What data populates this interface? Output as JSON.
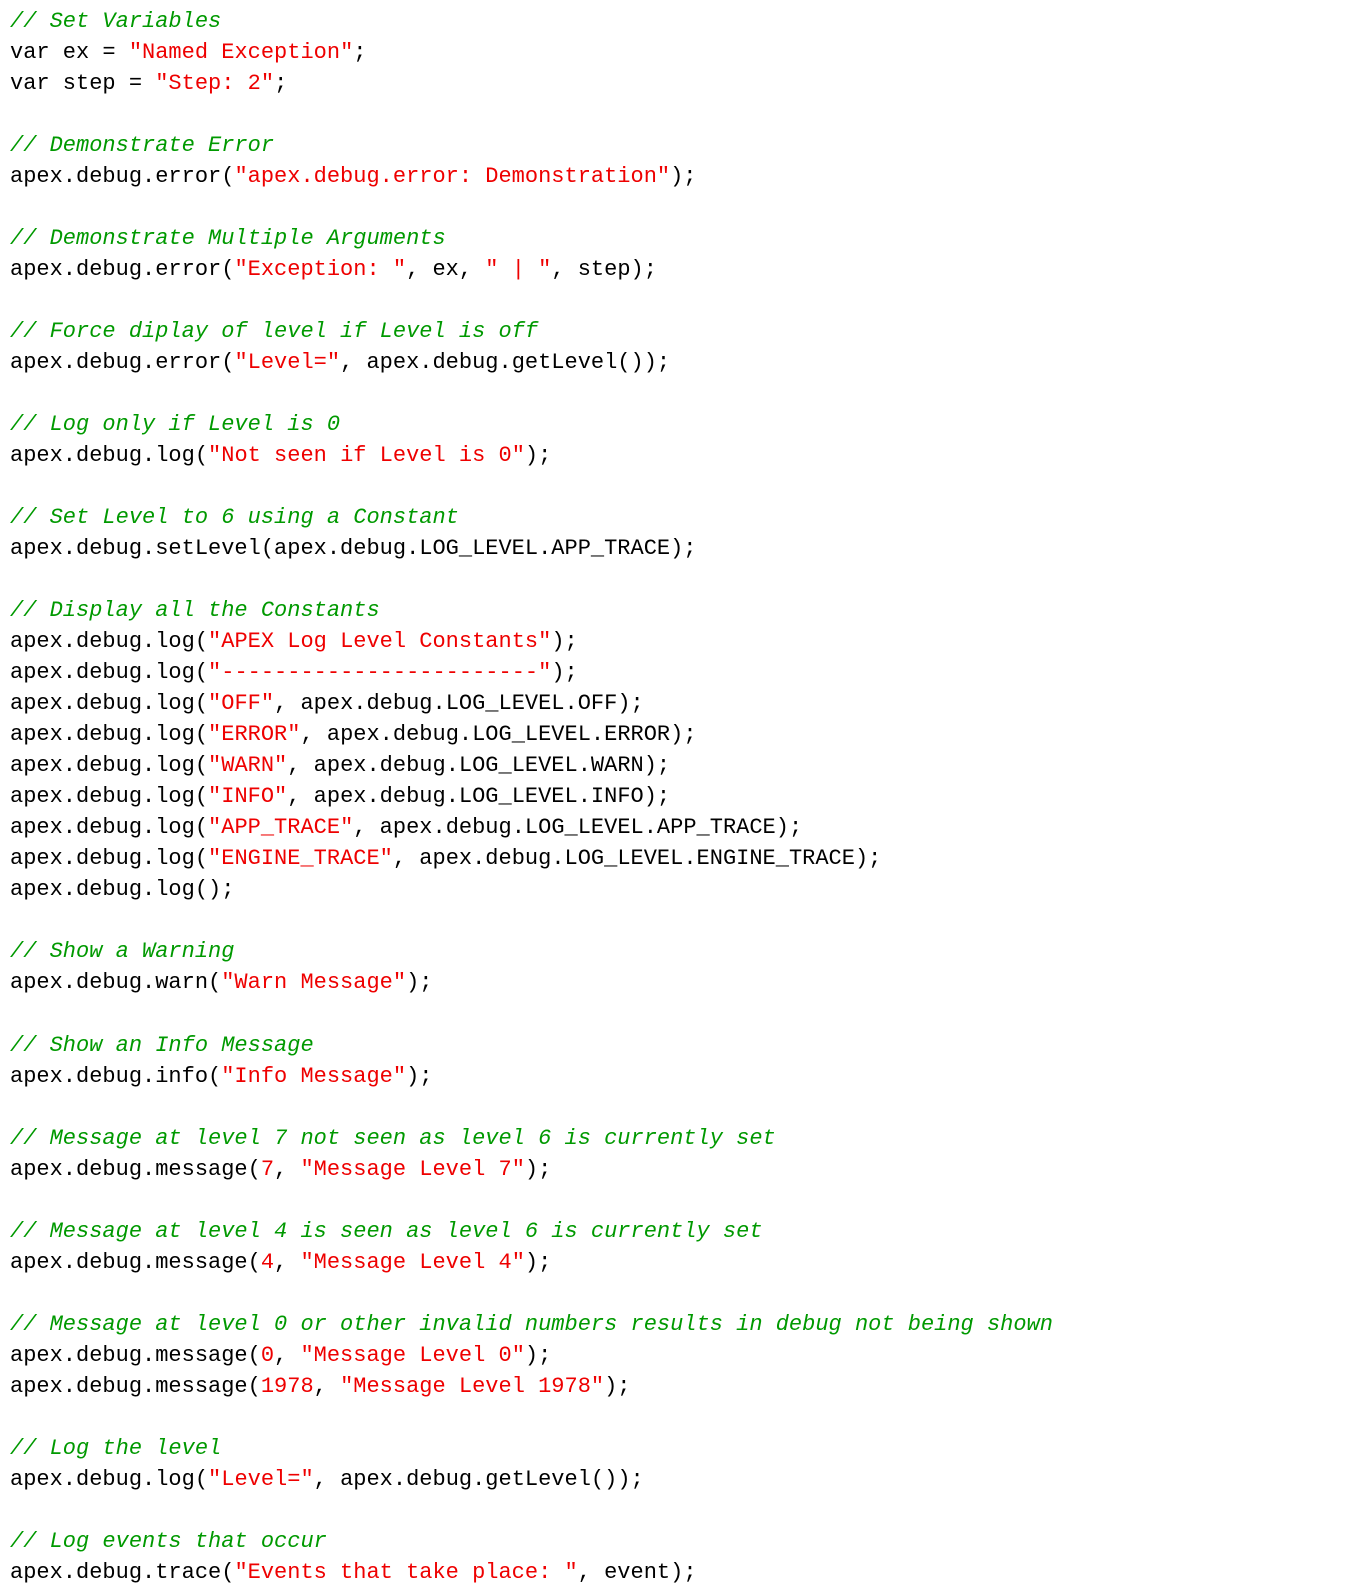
{
  "code_text": {
    "c_set_vars": "// Set Variables",
    "l_var_ex_pre": "var ex = ",
    "l_var_ex_str": "\"Named Exception\"",
    "l_var_ex_post": ";",
    "l_var_step_pre": "var step = ",
    "l_var_step_str": "\"Step: 2\"",
    "l_var_step_post": ";",
    "c_demo_error": "// Demonstrate Error",
    "l_demo_error_pre": "apex.debug.error(",
    "l_demo_error_str": "\"apex.debug.error: Demonstration\"",
    "l_demo_error_post": ");",
    "c_demo_multi": "// Demonstrate Multiple Arguments",
    "l_multi_pre": "apex.debug.error(",
    "l_multi_s1": "\"Exception: \"",
    "l_multi_sep1": ", ex, ",
    "l_multi_s2": "\" | \"",
    "l_multi_post": ", step);",
    "c_force": "// Force diplay of level if Level is off",
    "l_force_pre": "apex.debug.error(",
    "l_force_str": "\"Level=\"",
    "l_force_post": ", apex.debug.getLevel());",
    "c_logonly": "// Log only if Level is 0",
    "l_logonly_pre": "apex.debug.log(",
    "l_logonly_str": "\"Not seen if Level is 0\"",
    "l_logonly_post": ");",
    "c_setlevel": "// Set Level to 6 using a Constant",
    "l_setlevel": "apex.debug.setLevel(apex.debug.LOG_LEVEL.APP_TRACE);",
    "c_displayconst": "// Display all the Constants",
    "l_dc_a_pre": "apex.debug.log(",
    "l_dc_a_str": "\"APEX Log Level Constants\"",
    "l_dc_a_post": ");",
    "l_dc_b_pre": "apex.debug.log(",
    "l_dc_b_str": "\"------------------------\"",
    "l_dc_b_post": ");",
    "l_dc_off_pre": "apex.debug.log(",
    "l_dc_off_str": "\"OFF\"",
    "l_dc_off_post": ", apex.debug.LOG_LEVEL.OFF);",
    "l_dc_err_pre": "apex.debug.log(",
    "l_dc_err_str": "\"ERROR\"",
    "l_dc_err_post": ", apex.debug.LOG_LEVEL.ERROR);",
    "l_dc_warn_pre": "apex.debug.log(",
    "l_dc_warn_str": "\"WARN\"",
    "l_dc_warn_post": ", apex.debug.LOG_LEVEL.WARN);",
    "l_dc_info_pre": "apex.debug.log(",
    "l_dc_info_str": "\"INFO\"",
    "l_dc_info_post": ", apex.debug.LOG_LEVEL.INFO);",
    "l_dc_appt_pre": "apex.debug.log(",
    "l_dc_appt_str": "\"APP_TRACE\"",
    "l_dc_appt_post": ", apex.debug.LOG_LEVEL.APP_TRACE);",
    "l_dc_engt_pre": "apex.debug.log(",
    "l_dc_engt_str": "\"ENGINE_TRACE\"",
    "l_dc_engt_post": ", apex.debug.LOG_LEVEL.ENGINE_TRACE);",
    "l_dc_empty": "apex.debug.log();",
    "c_showwarn": "// Show a Warning",
    "l_showwarn_pre": "apex.debug.warn(",
    "l_showwarn_str": "\"Warn Message\"",
    "l_showwarn_post": ");",
    "c_showinfo": "// Show an Info Message",
    "l_showinfo_pre": "apex.debug.info(",
    "l_showinfo_str": "\"Info Message\"",
    "l_showinfo_post": ");",
    "c_msg7": "// Message at level 7 not seen as level 6 is currently set",
    "l_msg7_pre": "apex.debug.message(",
    "l_msg7_num": "7",
    "l_msg7_mid": ", ",
    "l_msg7_str": "\"Message Level 7\"",
    "l_msg7_post": ");",
    "c_msg4": "// Message at level 4 is seen as level 6 is currently set",
    "l_msg4_pre": "apex.debug.message(",
    "l_msg4_num": "4",
    "l_msg4_mid": ", ",
    "l_msg4_str": "\"Message Level 4\"",
    "l_msg4_post": ");",
    "c_msg0": "// Message at level 0 or other invalid numbers results in debug not being shown",
    "l_msg0_pre": "apex.debug.message(",
    "l_msg0_num": "0",
    "l_msg0_mid": ", ",
    "l_msg0_str": "\"Message Level 0\"",
    "l_msg0_post": ");",
    "l_msg1978_pre": "apex.debug.message(",
    "l_msg1978_num": "1978",
    "l_msg1978_mid": ", ",
    "l_msg1978_str": "\"Message Level 1978\"",
    "l_msg1978_post": ");",
    "c_loglevel": "// Log the level",
    "l_loglevel_pre": "apex.debug.log(",
    "l_loglevel_str": "\"Level=\"",
    "l_loglevel_post": ", apex.debug.getLevel());",
    "c_logevents": "// Log events that occur",
    "l_trace_pre": "apex.debug.trace(",
    "l_trace_str": "\"Events that take place: \"",
    "l_trace_post": ", event);"
  }
}
